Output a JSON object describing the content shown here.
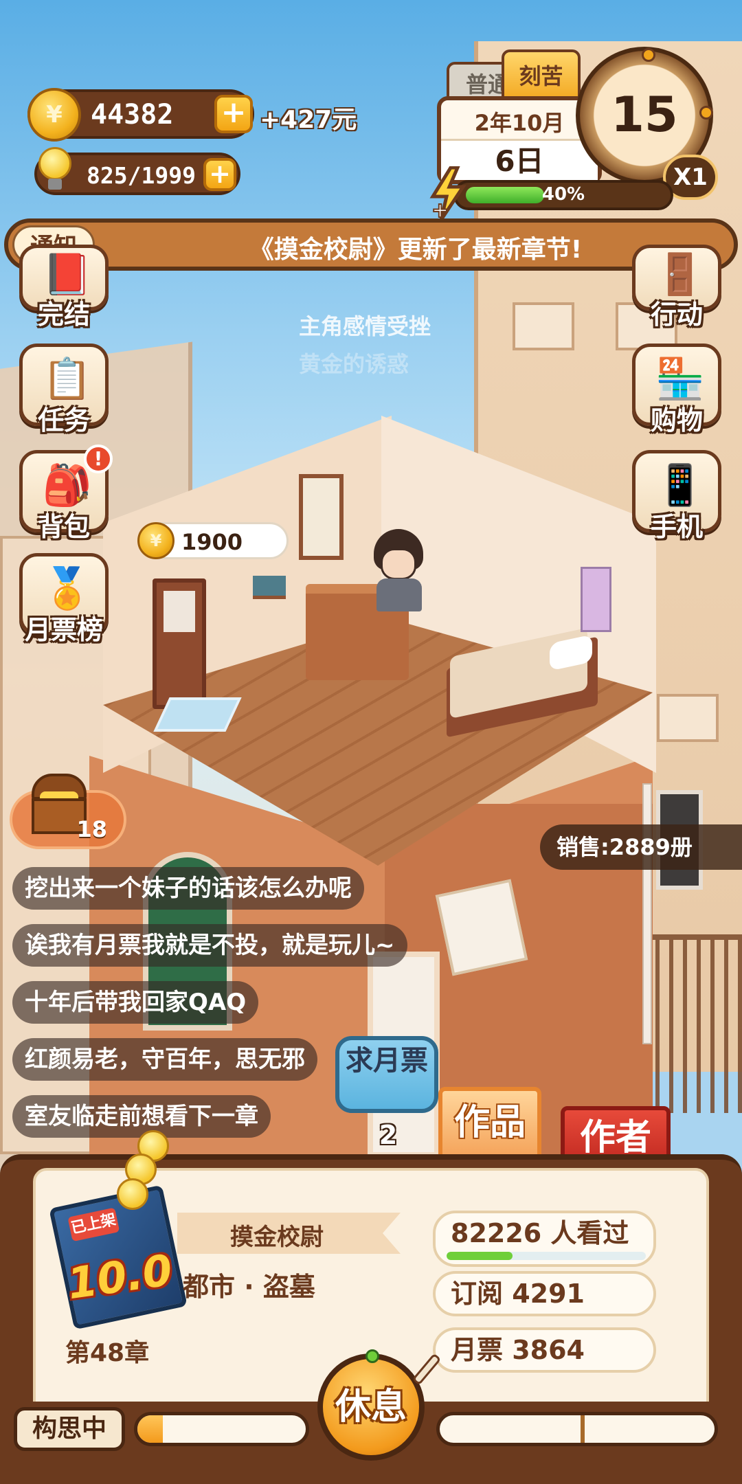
{
  "hud": {
    "gold": "44382",
    "income": "+427元",
    "ideas": "825/1999",
    "plus": "+",
    "coin_symbol": "¥"
  },
  "calendar": {
    "mode_normal": "普通",
    "mode_hard": "刻苦",
    "month": "2年10月",
    "day": "6日",
    "clock_value": "15",
    "speed": "X1",
    "energy_label": "40%",
    "energy_fraction": 0.4
  },
  "notice": {
    "tag": "通知",
    "text": "《摸金校尉》更新了最新章节!"
  },
  "left_menu": [
    {
      "label": "完结",
      "icon": "book-icon",
      "glyph": "📕"
    },
    {
      "label": "任务",
      "icon": "checklist-icon",
      "glyph": "📋"
    },
    {
      "label": "背包",
      "icon": "backpack-icon",
      "glyph": "🎒",
      "badge": "!"
    },
    {
      "label": "月票榜",
      "icon": "medal-icon",
      "glyph": "🏅"
    }
  ],
  "right_menu": [
    {
      "label": "行动",
      "icon": "door-icon",
      "glyph": "🚪"
    },
    {
      "label": "购物",
      "icon": "shop-icon",
      "glyph": "🏪"
    },
    {
      "label": "手机",
      "icon": "phone-icon",
      "glyph": "📱"
    }
  ],
  "scene": {
    "floating_text_1": "主角感情受挫",
    "floating_text_2": "黄金的诱惑",
    "coin_bubble": "1900",
    "treasure_count": "18",
    "sales": "销售:2889册"
  },
  "comments": [
    "挖出来一个妹子的话该怎么办呢",
    "诶我有月票我就是不投，就是玩儿~",
    "十年后带我回家QAQ",
    "红颜易老，守百年，思无邪",
    "室友临走前想看下一章"
  ],
  "actions": {
    "request_ticket": "求月票",
    "request_count": "2",
    "tab_works": "作品",
    "tab_author": "作者"
  },
  "book": {
    "stamp": "已上架",
    "rating": "10.0",
    "title": "摸金校尉",
    "genre": "都市 · 盗墓",
    "chapter": "第48章",
    "views": "82226   人看过",
    "views_fraction": 0.33,
    "subscriptions": "订阅 4291",
    "monthly_tickets": "月票 3864"
  },
  "footer": {
    "status": "构思中",
    "progress_fraction": 0.15,
    "rest_button": "休息",
    "right_progress_fraction": 0.0
  },
  "colors": {
    "brown": "#6b3a1e",
    "orange": "#f39a1c",
    "notice": "#c47a3a"
  }
}
